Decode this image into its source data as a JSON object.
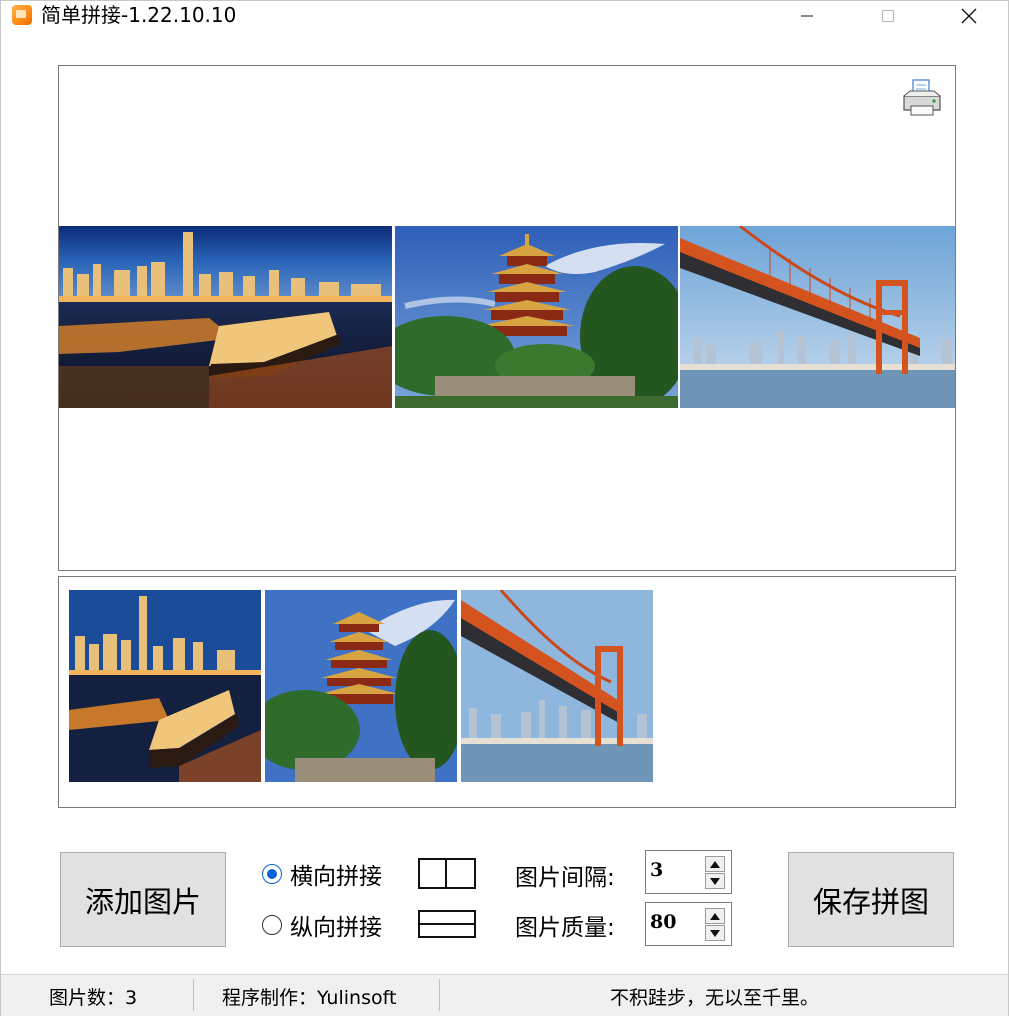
{
  "window": {
    "title": "简单拼接-1.22.10.10",
    "controls": {
      "minimize": "minimize-icon",
      "maximize": "maximize-icon",
      "close": "close-icon"
    }
  },
  "preview": {
    "print_icon": "printer-icon",
    "images": [
      "wuhan-night-riverfront-photo",
      "yellow-crane-tower-photo",
      "yangtze-river-bridge-photo"
    ]
  },
  "thumbnails": [
    "wuhan-night-riverfront-photo",
    "yellow-crane-tower-photo",
    "yangtze-river-bridge-photo"
  ],
  "controls": {
    "add_button": "添加图片",
    "save_button": "保存拼图",
    "horizontal_label": "横向拼接",
    "vertical_label": "纵向拼接",
    "selected_mode": "horizontal",
    "gap_label": "图片间隔:",
    "gap_value": "3",
    "quality_label": "图片质量:",
    "quality_value": "80"
  },
  "status": {
    "count": "图片数：3",
    "author": "程序制作：Yulinsoft",
    "motto": "不积跬步，无以至千里。"
  },
  "colors": {
    "radio_accent": "#0a64d6",
    "button_face": "#e1e1e1",
    "status_bg": "#f0f0f0"
  }
}
